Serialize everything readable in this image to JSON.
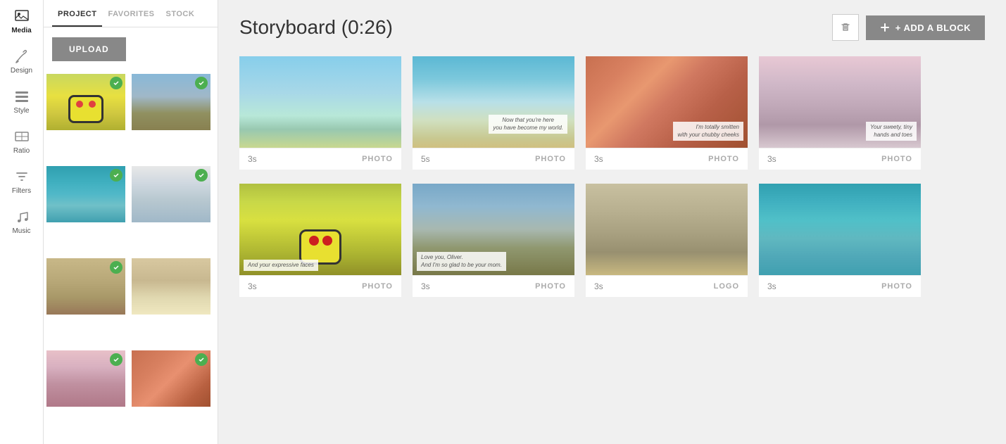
{
  "iconSidebar": {
    "items": [
      {
        "id": "media",
        "label": "Media",
        "icon": "image-icon",
        "active": true
      },
      {
        "id": "design",
        "label": "Design",
        "icon": "brush-icon",
        "active": false
      },
      {
        "id": "style",
        "label": "Style",
        "icon": "style-icon",
        "active": false
      },
      {
        "id": "ratio",
        "label": "Ratio",
        "icon": "ratio-icon",
        "active": false
      },
      {
        "id": "filters",
        "label": "Filters",
        "icon": "filters-icon",
        "active": false
      },
      {
        "id": "music",
        "label": "Music",
        "icon": "music-icon",
        "active": false
      }
    ]
  },
  "leftPanel": {
    "tabs": [
      {
        "id": "project",
        "label": "PROJECT",
        "active": true
      },
      {
        "id": "favorites",
        "label": "FAVORITES",
        "active": false
      },
      {
        "id": "stock",
        "label": "STOCK",
        "active": false
      }
    ],
    "uploadButton": "UPLOAD",
    "thumbnails": [
      {
        "id": "thumb-1",
        "checked": true,
        "color": "emoji-yellow"
      },
      {
        "id": "thumb-2",
        "checked": true,
        "color": "elephant"
      },
      {
        "id": "thumb-3",
        "checked": true,
        "color": "ocean-teal"
      },
      {
        "id": "thumb-4",
        "checked": true,
        "color": "ocean-white"
      },
      {
        "id": "thumb-5",
        "checked": true,
        "color": "statue"
      },
      {
        "id": "thumb-6",
        "checked": false,
        "color": "beach-sand"
      },
      {
        "id": "thumb-7",
        "checked": true,
        "color": "mountains-pink"
      },
      {
        "id": "thumb-8",
        "checked": true,
        "color": "cave-red"
      }
    ]
  },
  "header": {
    "title": "Storyboard (0:26)",
    "deleteButton": "delete",
    "addBlockButton": "+ ADD A BLOCK"
  },
  "storyboard": {
    "rows": [
      {
        "id": "row-1",
        "blocks": [
          {
            "id": "block-1",
            "duration": "3s",
            "type": "PHOTO",
            "imageClass": "img-sky-beach",
            "overlay": null
          },
          {
            "id": "block-2",
            "duration": "5s",
            "type": "PHOTO",
            "imageClass": "img-ocean-cliff",
            "overlay": {
              "text": "Now that you're here\nyou have become my world.",
              "position": "center"
            }
          },
          {
            "id": "block-3",
            "duration": "3s",
            "type": "PHOTO",
            "imageClass": "img-cave-red",
            "overlay": {
              "text": "I'm totally smitten\nwith your chubby cheeks",
              "position": "bottom-right"
            }
          },
          {
            "id": "block-4",
            "duration": "3s",
            "type": "PHOTO",
            "imageClass": "img-desert-pink",
            "overlay": {
              "text": "Your sweet, tiny\nhands and toes",
              "position": "bottom-right"
            }
          }
        ]
      },
      {
        "id": "row-2",
        "blocks": [
          {
            "id": "block-5",
            "duration": "3s",
            "type": "PHOTO",
            "imageClass": "img-emoji-yellow",
            "overlay": {
              "text": "And your expressive faces",
              "position": "bottom-left"
            }
          },
          {
            "id": "block-6",
            "duration": "3s",
            "type": "PHOTO",
            "imageClass": "img-elephant",
            "overlay": {
              "text": "Love you, Oliver.\nAnd I'm so glad to be your mom.",
              "position": "bottom-left"
            }
          },
          {
            "id": "block-7",
            "duration": "3s",
            "type": "LOGO",
            "imageClass": "img-statue",
            "overlay": null
          },
          {
            "id": "block-8",
            "duration": "3s",
            "type": "PHOTO",
            "imageClass": "img-ocean-teal",
            "overlay": null
          }
        ]
      }
    ]
  },
  "colors": {
    "accent": "#888888",
    "activeTab": "#333333",
    "checkmark": "#4caf50"
  }
}
